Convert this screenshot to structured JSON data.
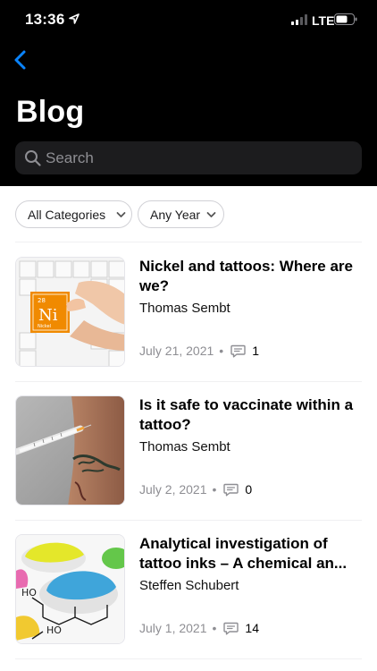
{
  "status_bar": {
    "time": "13:36",
    "network": "LTE"
  },
  "nav": {
    "back_icon": "chevron-left-icon"
  },
  "page": {
    "title": "Blog"
  },
  "search": {
    "placeholder": "Search"
  },
  "filters": [
    {
      "label": "All Categories"
    },
    {
      "label": "Any Year"
    }
  ],
  "posts": [
    {
      "title": "Nickel and tattoos: Where are we?",
      "author": "Thomas Sembt",
      "date": "July 21, 2021",
      "comments": "1",
      "thumb_text": {
        "number": "28",
        "symbol": "Ni",
        "name": "Nickel"
      }
    },
    {
      "title": "Is it safe to vaccinate within a tattoo?",
      "author": "Thomas Sembt",
      "date": "July 2, 2021",
      "comments": "0"
    },
    {
      "title": "Analytical investigation of tattoo inks – A chemical an...",
      "author": "Steffen Schubert",
      "date": "July 1, 2021",
      "comments": "14",
      "thumb_text": {
        "label_a": "HO",
        "label_b": "HO"
      }
    }
  ],
  "colors": {
    "accent": "#0a84ff",
    "header_bg": "#000000",
    "search_bg": "#1c1c1e",
    "meta": "#8e8e93"
  }
}
